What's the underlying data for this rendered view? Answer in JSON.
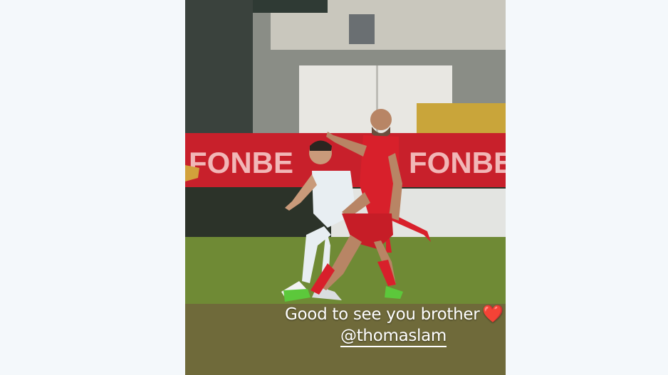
{
  "story": {
    "caption_text": "Good to see you brother",
    "caption_emoji": "❤️",
    "mention": "@thomaslam",
    "banner_text": "FONBE",
    "banner_text_right": "FONBE"
  },
  "colors": {
    "page_background": "#f4f8fb",
    "pitch": "#6f8a35",
    "banner": "#c8202b",
    "red_kit": "#d8202b",
    "white_kit": "#e8eef2"
  }
}
